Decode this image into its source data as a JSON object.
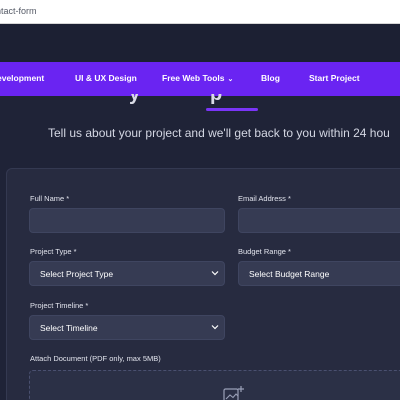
{
  "browser": {
    "url": "ntact-form"
  },
  "nav": {
    "items": [
      {
        "label": "evelopment"
      },
      {
        "label": "UI & UX Design"
      },
      {
        "label": "Free Web Tools"
      },
      {
        "label": "Blog"
      },
      {
        "label": "Start Project"
      }
    ]
  },
  "hero": {
    "subtitle": "Tell us about your project and we'll get back to you within 24 hou"
  },
  "form": {
    "full_name_label": "Full Name *",
    "email_label": "Email Address *",
    "project_type_label": "Project Type *",
    "project_type_value": "Select Project Type",
    "budget_label": "Budget Range *",
    "budget_value": "Select Budget Range",
    "timeline_label": "Project Timeline *",
    "timeline_value": "Select Timeline",
    "attach_label": "Attach Document (PDF only, max 5MB)"
  },
  "colors": {
    "background": "#1f2337",
    "nav": "#6a24f2",
    "card": "#272b40",
    "field": "#363b53",
    "accent": "#7a35f7"
  },
  "icons": {
    "select_caret": "chevron-down-icon",
    "upload": "image-add-icon"
  }
}
